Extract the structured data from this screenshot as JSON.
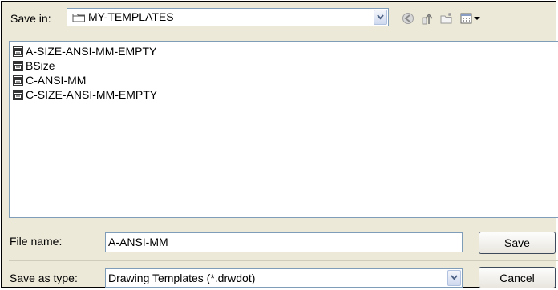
{
  "dialog": {
    "save_in_label": "Save in:",
    "current_folder": "MY-TEMPLATES",
    "files": [
      "A-SIZE-ANSI-MM-EMPTY",
      "BSize",
      "C-ANSI-MM",
      "C-SIZE-ANSI-MM-EMPTY"
    ],
    "file_name_label": "File name:",
    "file_name_value": "A-ANSI-MM",
    "save_as_type_label": "Save as type:",
    "save_as_type_value": "Drawing Templates (*.drwdot)",
    "save_button": "Save",
    "cancel_button": "Cancel"
  },
  "toolbar_icons": [
    "back-icon",
    "up-folder-icon",
    "new-folder-icon",
    "view-menu-icon"
  ],
  "colors": {
    "dialog_bg": "#ece9d8",
    "field_border": "#7f9db9"
  }
}
